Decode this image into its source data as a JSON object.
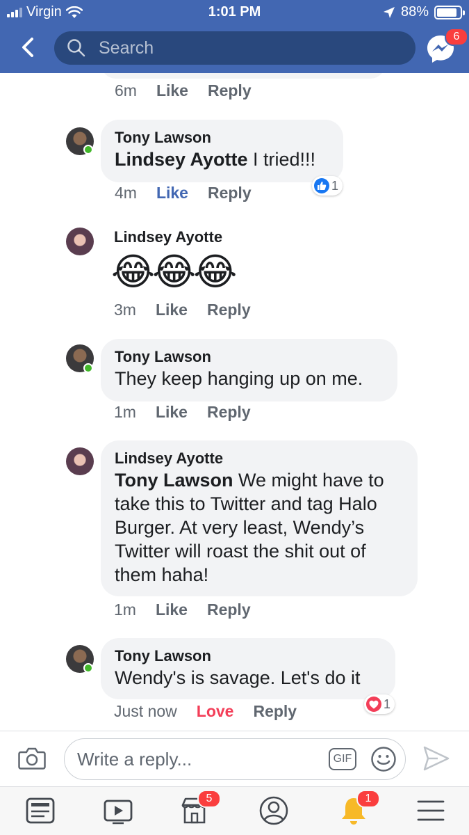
{
  "status_bar": {
    "carrier": "Virgin",
    "time": "1:01 PM",
    "battery": "88%"
  },
  "header": {
    "search_placeholder": "Search",
    "messenger_badge": "6"
  },
  "comments": [
    {
      "meta": {
        "time": "6m",
        "like": "Like",
        "reply": "Reply"
      }
    },
    {
      "author": "Tony Lawson",
      "mention": "Lindsey Ayotte",
      "text": " I tried!!!",
      "reaction_count": "1",
      "reaction_type": "like",
      "meta": {
        "time": "4m",
        "like": "Like",
        "reply": "Reply"
      }
    },
    {
      "author": "Lindsey Ayotte",
      "emojis": "😂😂😂",
      "meta": {
        "time": "3m",
        "like": "Like",
        "reply": "Reply"
      }
    },
    {
      "author": "Tony Lawson",
      "text": "They keep hanging up on me.",
      "meta": {
        "time": "1m",
        "like": "Like",
        "reply": "Reply"
      }
    },
    {
      "author": "Lindsey Ayotte",
      "mention": "Tony Lawson",
      "text_lines": [
        " We might have to",
        "take this to Twitter and tag Halo",
        "Burger. At very least, Wendy’s",
        "Twitter will roast the shit out of",
        "them haha!"
      ],
      "meta": {
        "time": "1m",
        "like": "Like",
        "reply": "Reply"
      }
    },
    {
      "author": "Tony Lawson",
      "text": "Wendy's is savage. Let's do it",
      "reaction_count": "1",
      "reaction_type": "love",
      "meta": {
        "time": "Just now",
        "like": "Love",
        "reply": "Reply"
      }
    }
  ],
  "reply_bar": {
    "placeholder": "Write a reply...",
    "gif_label": "GIF"
  },
  "tab_bar": {
    "tabs": [
      "news-feed",
      "watch",
      "marketplace",
      "profile",
      "notifications",
      "menu"
    ],
    "marketplace_badge": "5",
    "notifications_badge": "1"
  },
  "colors": {
    "brand": "#4267b2",
    "like_blue": "#4267b2",
    "love_red": "#f33e58",
    "badge_red": "#fa3e3e",
    "bubble_gray": "#f2f3f5"
  }
}
